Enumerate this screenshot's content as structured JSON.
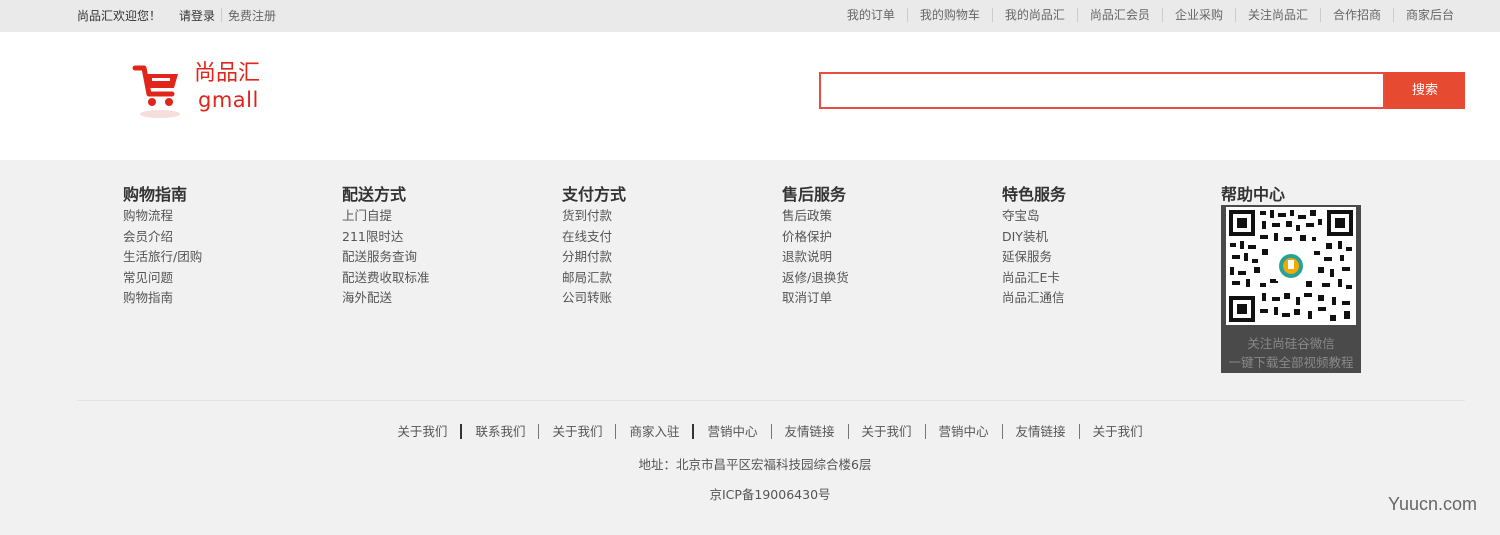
{
  "topbar": {
    "welcome": "尚品汇欢迎您！",
    "login": "请登录",
    "register": "免费注册",
    "nav": [
      "我的订单",
      "我的购物车",
      "我的尚品汇",
      "尚品汇会员",
      "企业采购",
      "关注尚品汇",
      "合作招商",
      "商家后台"
    ]
  },
  "header": {
    "logo_cn": "尚品汇",
    "logo_en": "gmall",
    "search_placeholder": "",
    "search_button": "搜索"
  },
  "help": {
    "columns": [
      {
        "title": "购物指南",
        "links": [
          "购物流程",
          "会员介绍",
          "生活旅行/团购",
          "常见问题",
          "购物指南"
        ]
      },
      {
        "title": "配送方式",
        "links": [
          "上门自提",
          "211限时达",
          "配送服务查询",
          "配送费收取标准",
          "海外配送"
        ]
      },
      {
        "title": "支付方式",
        "links": [
          "货到付款",
          "在线支付",
          "分期付款",
          "邮局汇款",
          "公司转账"
        ]
      },
      {
        "title": "售后服务",
        "links": [
          "售后政策",
          "价格保护",
          "退款说明",
          "返修/退换货",
          "取消订单"
        ]
      },
      {
        "title": "特色服务",
        "links": [
          "夺宝岛",
          "DIY装机",
          "延保服务",
          "尚品汇E卡",
          "尚品汇通信"
        ]
      }
    ],
    "qr_title": "帮助中心",
    "qr_caption_1": "关注尚硅谷微信",
    "qr_caption_2": "一键下载全部视频教程"
  },
  "footer": {
    "links": [
      "关于我们",
      "联系我们",
      "关于我们",
      "商家入驻",
      "营销中心",
      "友情链接",
      "关于我们",
      "营销中心",
      "友情链接",
      "关于我们"
    ],
    "address": "地址：北京市昌平区宏福科技园综合楼6层",
    "icp": "京ICP备19006430号"
  },
  "watermark": "Yuucn.com",
  "colors": {
    "brand": "#e1251b",
    "search_button": "#e64a31",
    "topbar_bg": "#eaeaea",
    "footer_bg": "#f1f1f1"
  }
}
